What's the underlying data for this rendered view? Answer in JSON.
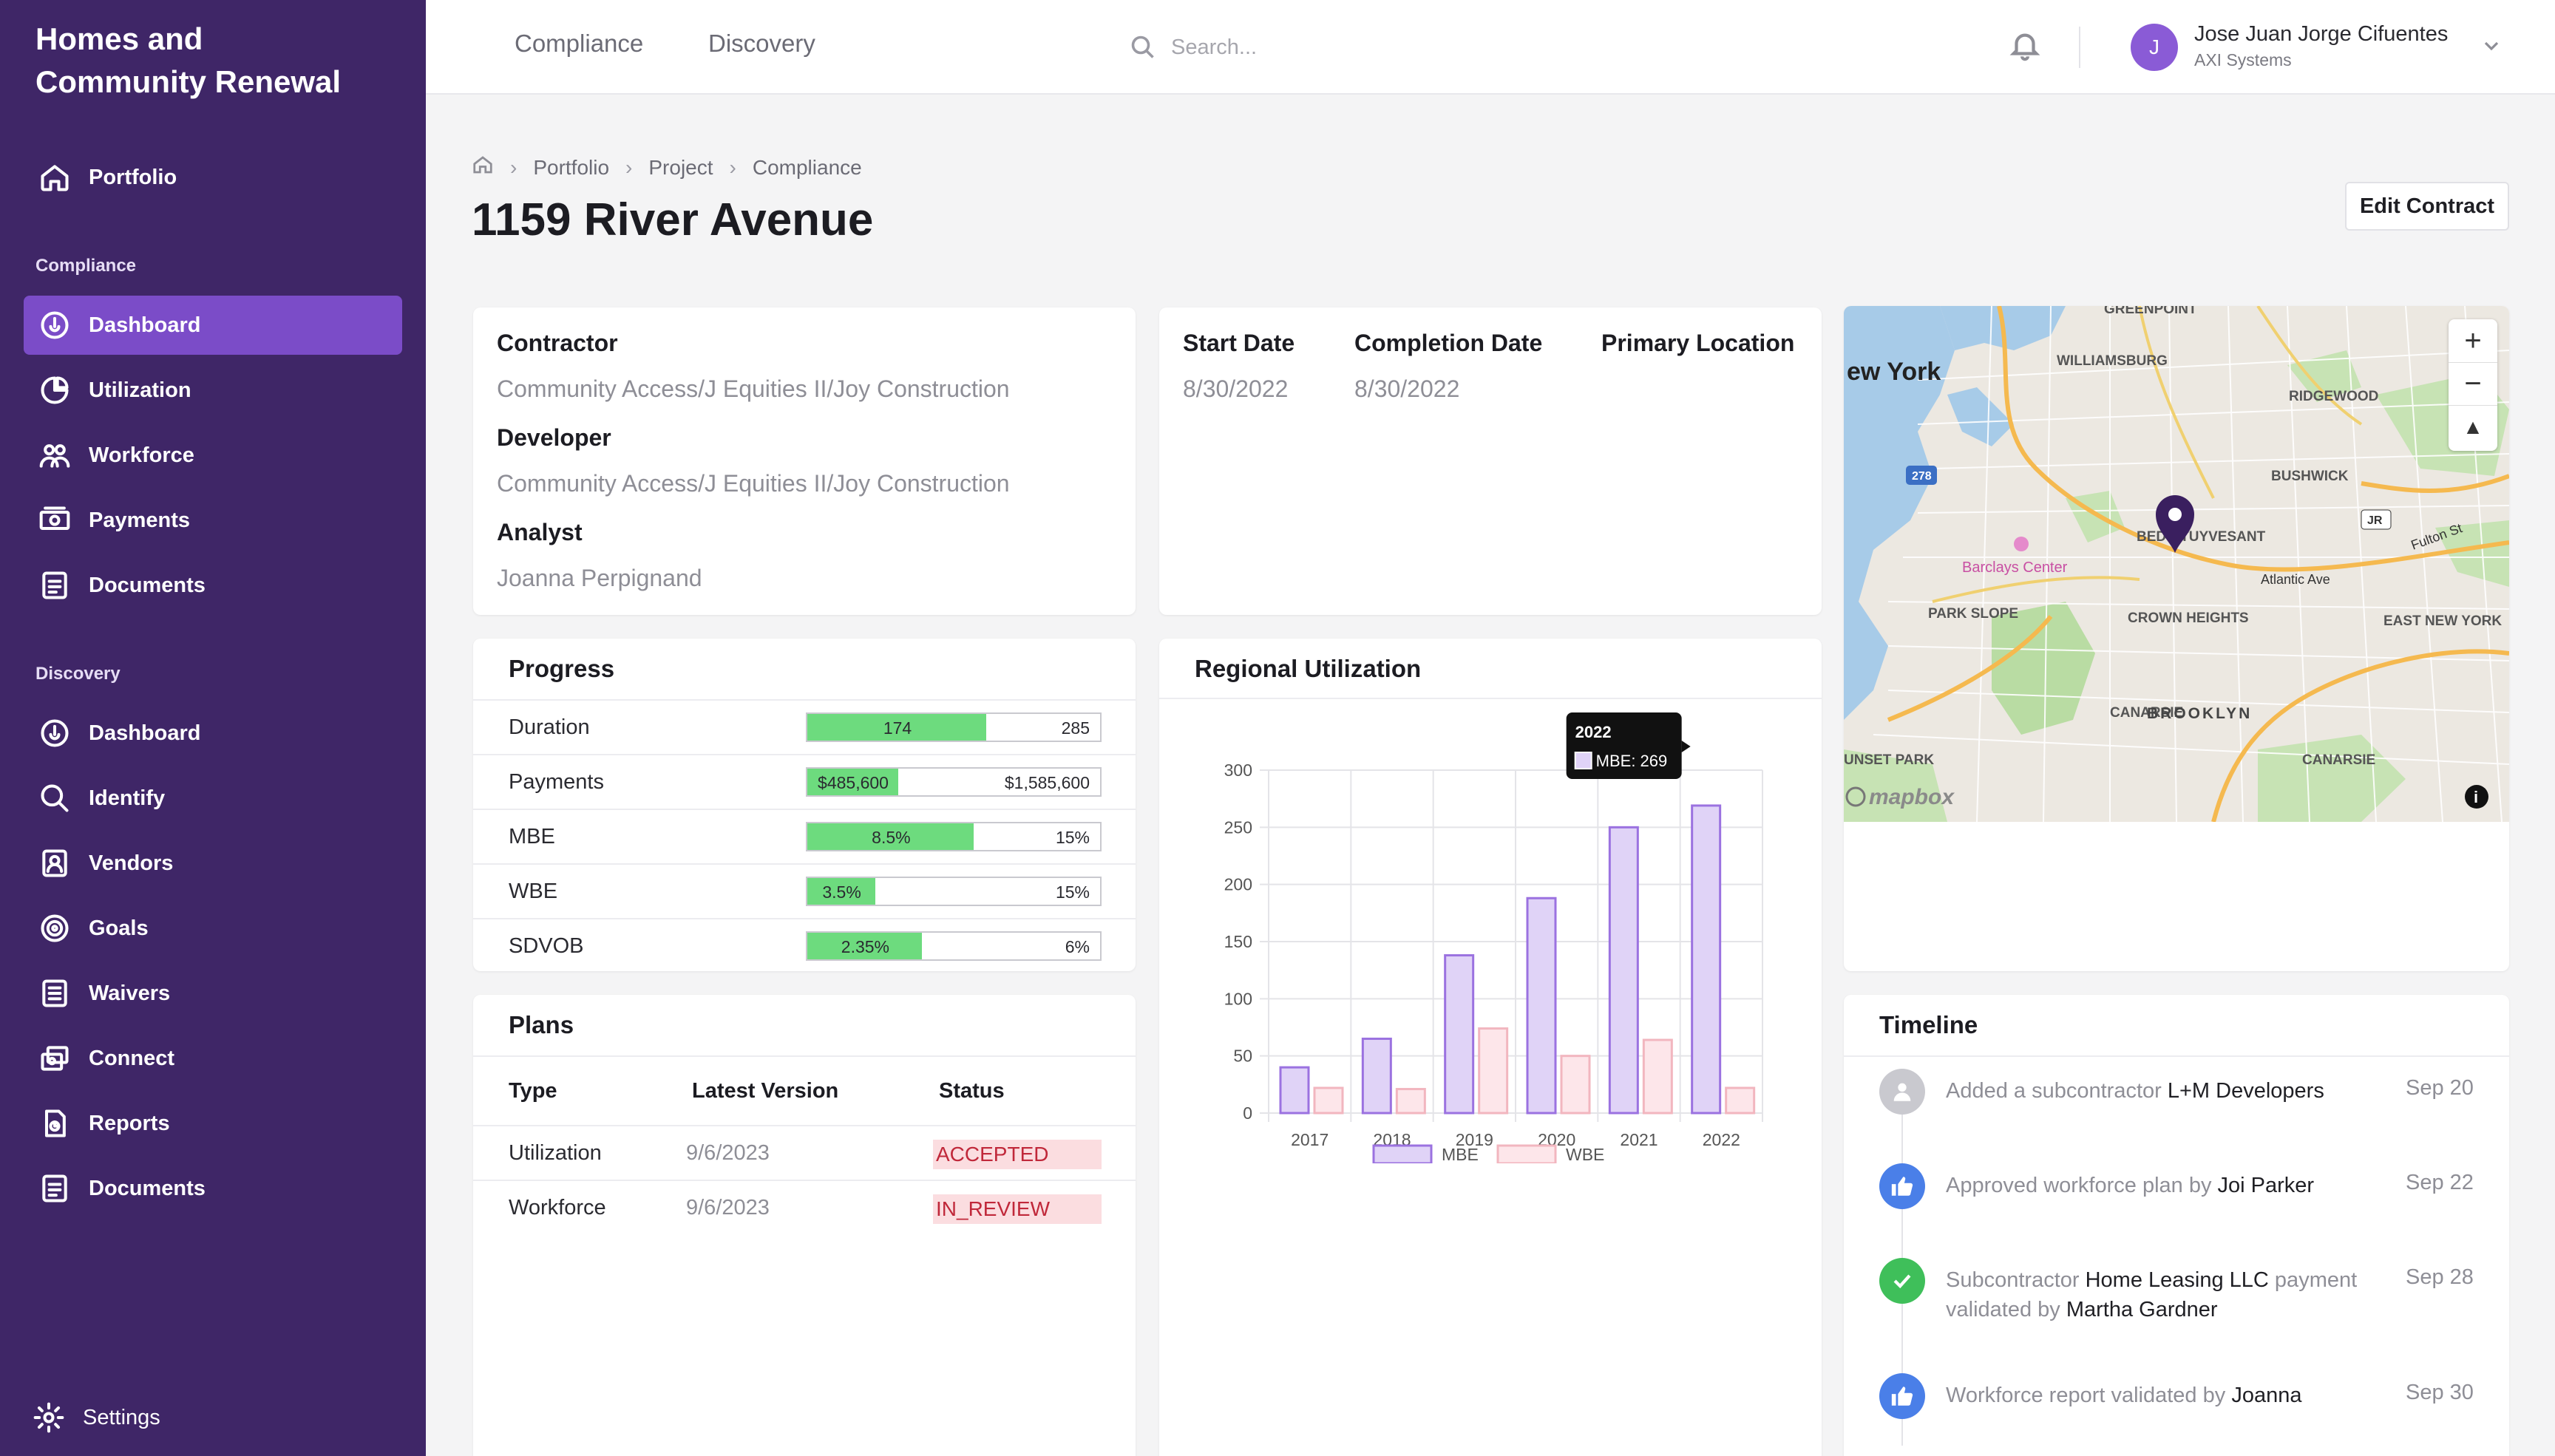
{
  "app": {
    "title_line1": "Homes and",
    "title_line2": "Community Renewal"
  },
  "sidebar": {
    "portfolio": "Portfolio",
    "compliance_label": "Compliance",
    "compliance_items": [
      {
        "label": "Dashboard",
        "icon": "dashboard-icon",
        "active": true
      },
      {
        "label": "Utilization",
        "icon": "pie-chart-icon"
      },
      {
        "label": "Workforce",
        "icon": "people-icon"
      },
      {
        "label": "Payments",
        "icon": "money-icon"
      },
      {
        "label": "Documents",
        "icon": "document-icon"
      }
    ],
    "discovery_label": "Discovery",
    "discovery_items": [
      {
        "label": "Dashboard",
        "icon": "dashboard-icon"
      },
      {
        "label": "Identify",
        "icon": "search-icon"
      },
      {
        "label": "Vendors",
        "icon": "vendor-badge-icon"
      },
      {
        "label": "Goals",
        "icon": "target-icon"
      },
      {
        "label": "Waivers",
        "icon": "list-icon"
      },
      {
        "label": "Connect",
        "icon": "connect-icon"
      },
      {
        "label": "Reports",
        "icon": "report-icon"
      },
      {
        "label": "Documents",
        "icon": "document-icon"
      }
    ],
    "settings": "Settings"
  },
  "topbar": {
    "tabs": [
      "Compliance",
      "Discovery"
    ],
    "search_placeholder": "Search...",
    "user": {
      "initial": "J",
      "name": "Jose Juan Jorge Cifuentes",
      "org": "AXI Systems"
    }
  },
  "breadcrumb": [
    "Portfolio",
    "Project",
    "Compliance"
  ],
  "page_title": "1159 River Avenue",
  "edit_button": "Edit Contract",
  "info": {
    "contractor_label": "Contractor",
    "contractor": "Community Access/J Equities II/Joy Construction",
    "developer_label": "Developer",
    "developer": "Community Access/J Equities II/Joy Construction",
    "analyst_label": "Analyst",
    "analyst": "Joanna Perpignand"
  },
  "dates": {
    "start_label": "Start Date",
    "start": "8/30/2022",
    "completion_label": "Completion Date",
    "completion": "8/30/2022",
    "location_label": "Primary Location"
  },
  "progress": {
    "title": "Progress",
    "rows": [
      {
        "label": "Duration",
        "value": "174",
        "total": "285",
        "fraction": 0.61
      },
      {
        "label": "Payments",
        "value": "$485,600",
        "total": "$1,585,600",
        "fraction": 0.31
      },
      {
        "label": "MBE",
        "value": "8.5%",
        "total": "15%",
        "fraction": 0.567
      },
      {
        "label": "WBE",
        "value": "3.5%",
        "total": "15%",
        "fraction": 0.233
      },
      {
        "label": "SDVOB",
        "value": "2.35%",
        "total": "6%",
        "fraction": 0.392
      }
    ]
  },
  "plans": {
    "title": "Plans",
    "headers": [
      "Type",
      "Latest Version",
      "Status"
    ],
    "rows": [
      {
        "type": "Utilization",
        "version": "9/6/2023",
        "status": "ACCEPTED"
      },
      {
        "type": "Workforce",
        "version": "9/6/2023",
        "status": "IN_REVIEW"
      }
    ]
  },
  "regional": {
    "title": "Regional Utilization"
  },
  "chart_data": {
    "type": "bar",
    "categories": [
      "2017",
      "2018",
      "2019",
      "2020",
      "2021",
      "2022"
    ],
    "series": [
      {
        "name": "MBE",
        "values": [
          40,
          65,
          138,
          188,
          250,
          269
        ]
      },
      {
        "name": "WBE",
        "values": [
          22,
          21,
          74,
          50,
          64,
          22
        ]
      }
    ],
    "ylim": [
      0,
      300
    ],
    "yticks": [
      "0",
      "50",
      "100",
      "150",
      "200",
      "250",
      "300"
    ],
    "tooltip": {
      "title": "2022",
      "label": "MBE: 269"
    },
    "legend": "bottom",
    "colors": {
      "MBE": "#9b72e0",
      "WBE": "#f2b6bf"
    }
  },
  "map": {
    "labels": [
      "ew York",
      "GREENPOINT",
      "WILLIAMSBURG",
      "RIDGEWOOD",
      "BUSHWICK",
      "Barclays Center",
      "BED-STUYVESANT",
      "Atlantic Ave",
      "Fulton St",
      "PARK SLOPE",
      "CROWN HEIGHTS",
      "EAST NEW YORK",
      "BROOKLYN",
      "CANARSIE",
      "UNSET PARK",
      "278",
      "JR"
    ],
    "attribution": "mapbox"
  },
  "timeline": {
    "title": "Timeline",
    "items": [
      {
        "pre": "Added a subcontractor ",
        "bold": "L+M Developers",
        "mid": "",
        "bold2": "",
        "date": "Sep 20",
        "icon": "user-icon"
      },
      {
        "pre": "Approved workforce plan by ",
        "bold": "Joi Parker",
        "mid": "",
        "bold2": "",
        "date": "Sep 22",
        "icon": "thumbs-up-icon"
      },
      {
        "pre": "Subcontractor ",
        "bold": "Home Leasing LLC",
        "mid": " payment validated by ",
        "bold2": "Martha Gardner",
        "date": "Sep 28",
        "icon": "check-icon"
      },
      {
        "pre": "Workforce report validated by ",
        "bold": "Joanna",
        "mid": "",
        "bold2": "",
        "date": "Sep 30",
        "icon": "thumbs-up-icon"
      }
    ]
  }
}
